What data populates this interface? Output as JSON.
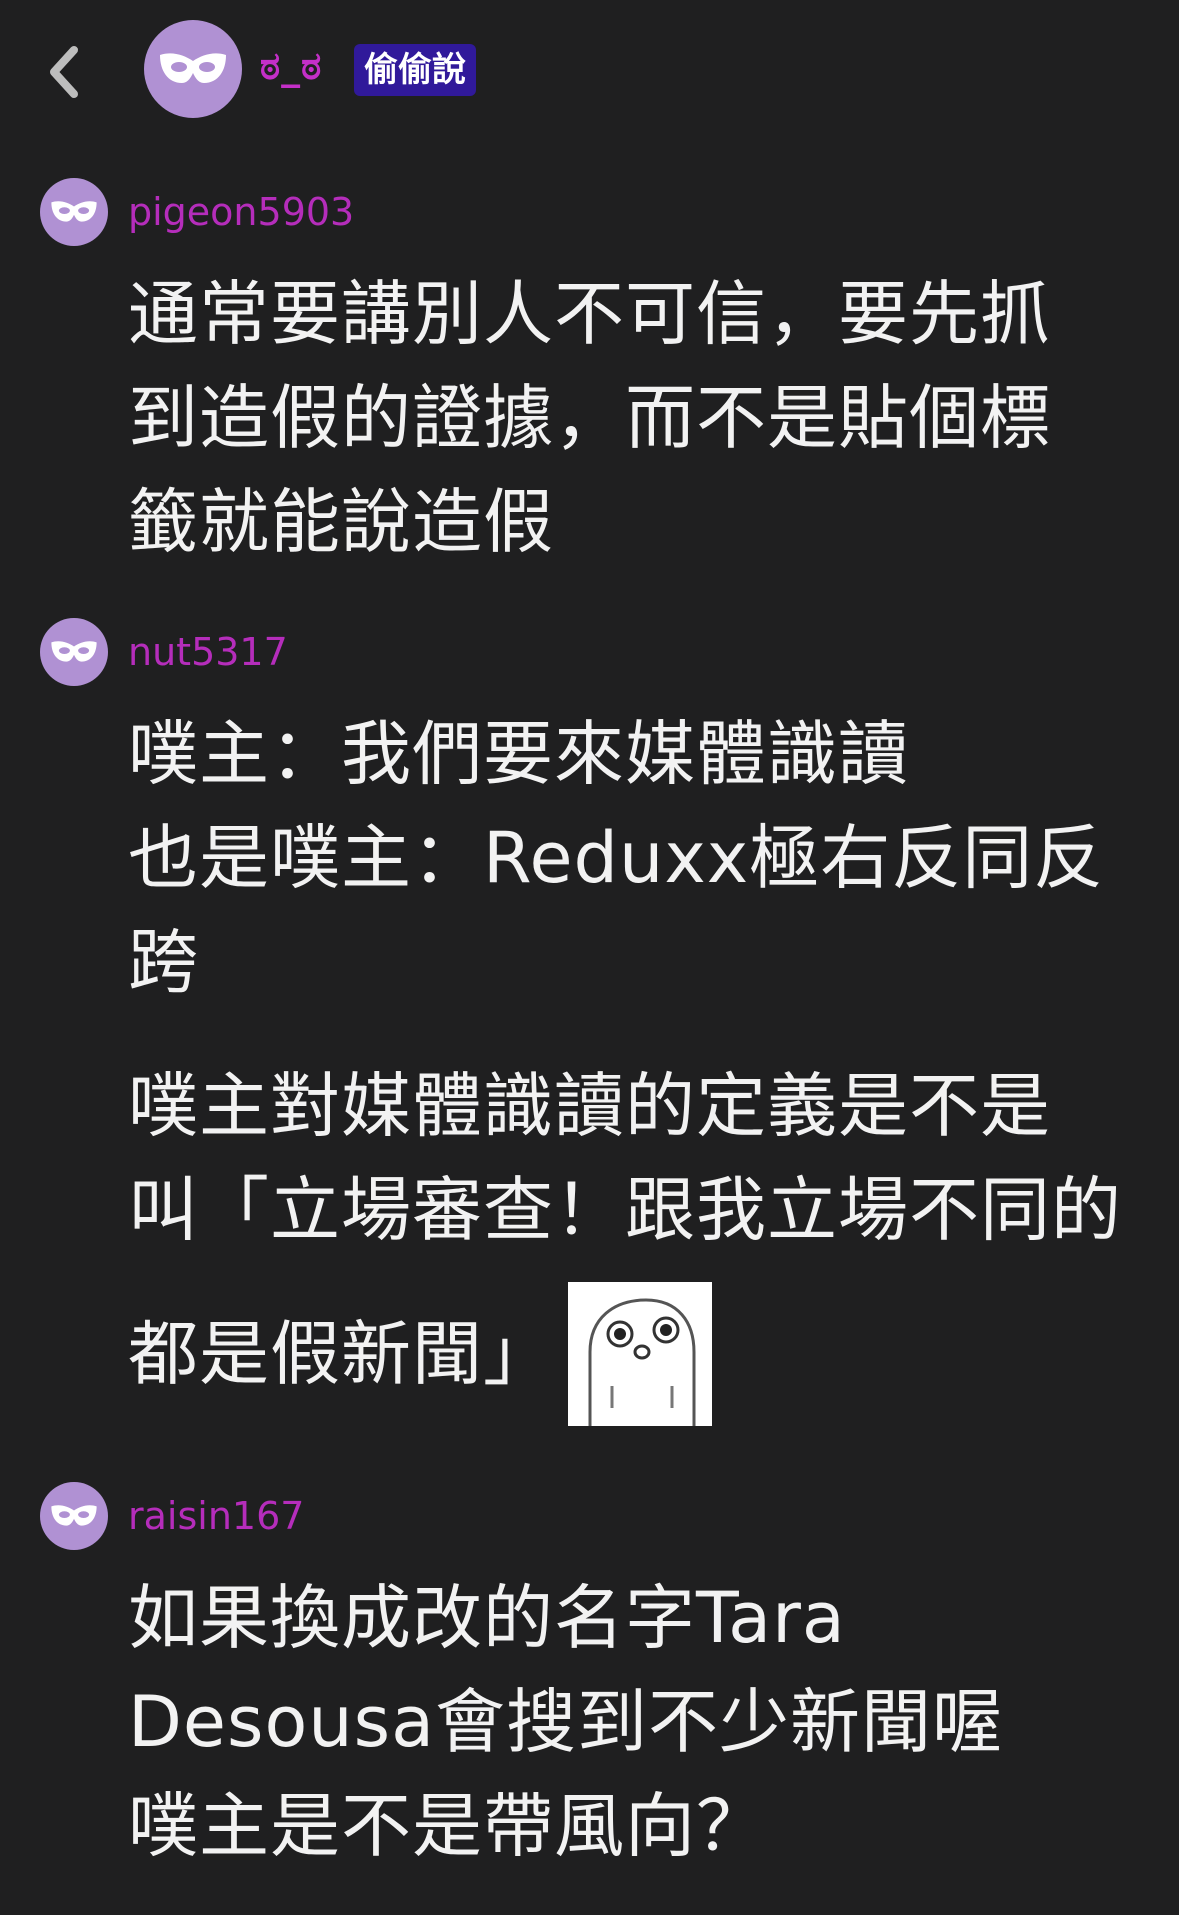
{
  "header": {
    "back_icon": "chevron-left-icon",
    "avatar_icon": "mask-icon",
    "name": "ಠ_ಠ",
    "badge": "偷偷說",
    "colors": {
      "name": "#c42fc8",
      "badge_bg": "#30199a",
      "avatar_bg": "#b091d3"
    }
  },
  "responses": [
    {
      "user": "pigeon5903",
      "avatar_icon": "mask-icon",
      "lines": [
        "通常要講別人不可信，要先抓",
        "到造假的證據，而不是貼個標",
        "籤就能說造假"
      ]
    },
    {
      "user": "nut5317",
      "avatar_icon": "mask-icon",
      "para1": [
        "噗主：我們要來媒體識讀",
        "也是噗主：Reduxx極右反同反",
        "跨"
      ],
      "para2": [
        "噗主對媒體識讀的定義是不是",
        "叫「立場審查！跟我立場不同的",
        "都是假新聞」"
      ],
      "sticker_icon": "bird-sticker-icon"
    },
    {
      "user": "raisin167",
      "avatar_icon": "mask-icon",
      "lines": [
        "如果換成改的名字Tara",
        "Desousa會搜到不少新聞喔",
        "噗主是不是帶風向？"
      ]
    }
  ],
  "colors": {
    "background": "#1f1f20",
    "username": "#b52dbb",
    "text": "#f2f2f2"
  }
}
